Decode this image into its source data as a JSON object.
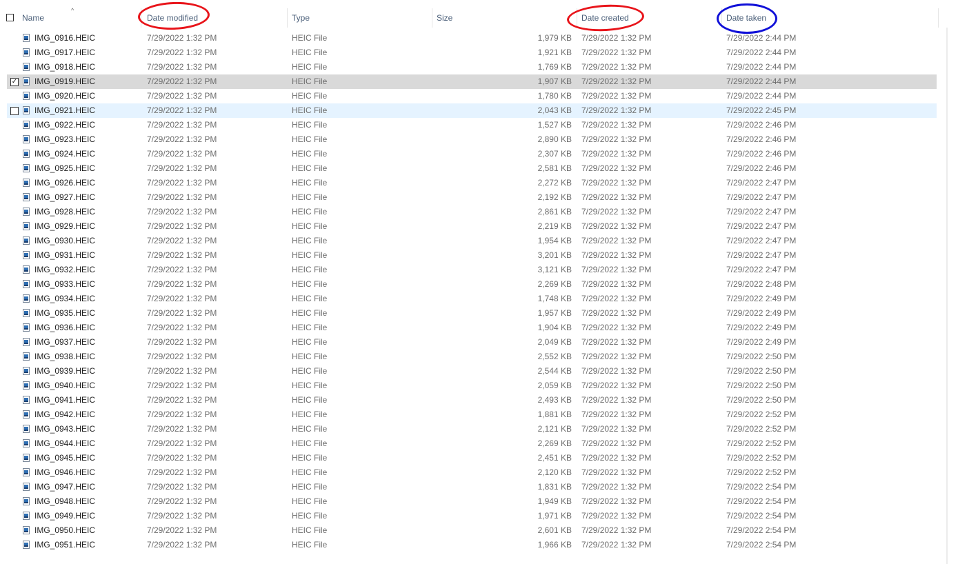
{
  "columns": {
    "name": "Name",
    "date_modified": "Date modified",
    "type": "Type",
    "size": "Size",
    "date_created": "Date created",
    "date_taken": "Date taken"
  },
  "annotation_colors": {
    "red": "#e8141a",
    "blue": "#1010d8"
  },
  "files": [
    {
      "name": "IMG_0916.HEIC",
      "modified": "7/29/2022 1:32 PM",
      "type": "HEIC File",
      "size": "1,979 KB",
      "created": "7/29/2022 1:32 PM",
      "taken": "7/29/2022 2:44 PM"
    },
    {
      "name": "IMG_0917.HEIC",
      "modified": "7/29/2022 1:32 PM",
      "type": "HEIC File",
      "size": "1,921 KB",
      "created": "7/29/2022 1:32 PM",
      "taken": "7/29/2022 2:44 PM"
    },
    {
      "name": "IMG_0918.HEIC",
      "modified": "7/29/2022 1:32 PM",
      "type": "HEIC File",
      "size": "1,769 KB",
      "created": "7/29/2022 1:32 PM",
      "taken": "7/29/2022 2:44 PM"
    },
    {
      "name": "IMG_0919.HEIC",
      "modified": "7/29/2022 1:32 PM",
      "type": "HEIC File",
      "size": "1,907 KB",
      "created": "7/29/2022 1:32 PM",
      "taken": "7/29/2022 2:44 PM",
      "state": "selected"
    },
    {
      "name": "IMG_0920.HEIC",
      "modified": "7/29/2022 1:32 PM",
      "type": "HEIC File",
      "size": "1,780 KB",
      "created": "7/29/2022 1:32 PM",
      "taken": "7/29/2022 2:44 PM"
    },
    {
      "name": "IMG_0921.HEIC",
      "modified": "7/29/2022 1:32 PM",
      "type": "HEIC File",
      "size": "2,043 KB",
      "created": "7/29/2022 1:32 PM",
      "taken": "7/29/2022 2:45 PM",
      "state": "hover"
    },
    {
      "name": "IMG_0922.HEIC",
      "modified": "7/29/2022 1:32 PM",
      "type": "HEIC File",
      "size": "1,527 KB",
      "created": "7/29/2022 1:32 PM",
      "taken": "7/29/2022 2:46 PM"
    },
    {
      "name": "IMG_0923.HEIC",
      "modified": "7/29/2022 1:32 PM",
      "type": "HEIC File",
      "size": "2,890 KB",
      "created": "7/29/2022 1:32 PM",
      "taken": "7/29/2022 2:46 PM"
    },
    {
      "name": "IMG_0924.HEIC",
      "modified": "7/29/2022 1:32 PM",
      "type": "HEIC File",
      "size": "2,307 KB",
      "created": "7/29/2022 1:32 PM",
      "taken": "7/29/2022 2:46 PM"
    },
    {
      "name": "IMG_0925.HEIC",
      "modified": "7/29/2022 1:32 PM",
      "type": "HEIC File",
      "size": "2,581 KB",
      "created": "7/29/2022 1:32 PM",
      "taken": "7/29/2022 2:46 PM"
    },
    {
      "name": "IMG_0926.HEIC",
      "modified": "7/29/2022 1:32 PM",
      "type": "HEIC File",
      "size": "2,272 KB",
      "created": "7/29/2022 1:32 PM",
      "taken": "7/29/2022 2:47 PM"
    },
    {
      "name": "IMG_0927.HEIC",
      "modified": "7/29/2022 1:32 PM",
      "type": "HEIC File",
      "size": "2,192 KB",
      "created": "7/29/2022 1:32 PM",
      "taken": "7/29/2022 2:47 PM"
    },
    {
      "name": "IMG_0928.HEIC",
      "modified": "7/29/2022 1:32 PM",
      "type": "HEIC File",
      "size": "2,861 KB",
      "created": "7/29/2022 1:32 PM",
      "taken": "7/29/2022 2:47 PM"
    },
    {
      "name": "IMG_0929.HEIC",
      "modified": "7/29/2022 1:32 PM",
      "type": "HEIC File",
      "size": "2,219 KB",
      "created": "7/29/2022 1:32 PM",
      "taken": "7/29/2022 2:47 PM"
    },
    {
      "name": "IMG_0930.HEIC",
      "modified": "7/29/2022 1:32 PM",
      "type": "HEIC File",
      "size": "1,954 KB",
      "created": "7/29/2022 1:32 PM",
      "taken": "7/29/2022 2:47 PM"
    },
    {
      "name": "IMG_0931.HEIC",
      "modified": "7/29/2022 1:32 PM",
      "type": "HEIC File",
      "size": "3,201 KB",
      "created": "7/29/2022 1:32 PM",
      "taken": "7/29/2022 2:47 PM"
    },
    {
      "name": "IMG_0932.HEIC",
      "modified": "7/29/2022 1:32 PM",
      "type": "HEIC File",
      "size": "3,121 KB",
      "created": "7/29/2022 1:32 PM",
      "taken": "7/29/2022 2:47 PM"
    },
    {
      "name": "IMG_0933.HEIC",
      "modified": "7/29/2022 1:32 PM",
      "type": "HEIC File",
      "size": "2,269 KB",
      "created": "7/29/2022 1:32 PM",
      "taken": "7/29/2022 2:48 PM"
    },
    {
      "name": "IMG_0934.HEIC",
      "modified": "7/29/2022 1:32 PM",
      "type": "HEIC File",
      "size": "1,748 KB",
      "created": "7/29/2022 1:32 PM",
      "taken": "7/29/2022 2:49 PM"
    },
    {
      "name": "IMG_0935.HEIC",
      "modified": "7/29/2022 1:32 PM",
      "type": "HEIC File",
      "size": "1,957 KB",
      "created": "7/29/2022 1:32 PM",
      "taken": "7/29/2022 2:49 PM"
    },
    {
      "name": "IMG_0936.HEIC",
      "modified": "7/29/2022 1:32 PM",
      "type": "HEIC File",
      "size": "1,904 KB",
      "created": "7/29/2022 1:32 PM",
      "taken": "7/29/2022 2:49 PM"
    },
    {
      "name": "IMG_0937.HEIC",
      "modified": "7/29/2022 1:32 PM",
      "type": "HEIC File",
      "size": "2,049 KB",
      "created": "7/29/2022 1:32 PM",
      "taken": "7/29/2022 2:49 PM"
    },
    {
      "name": "IMG_0938.HEIC",
      "modified": "7/29/2022 1:32 PM",
      "type": "HEIC File",
      "size": "2,552 KB",
      "created": "7/29/2022 1:32 PM",
      "taken": "7/29/2022 2:50 PM"
    },
    {
      "name": "IMG_0939.HEIC",
      "modified": "7/29/2022 1:32 PM",
      "type": "HEIC File",
      "size": "2,544 KB",
      "created": "7/29/2022 1:32 PM",
      "taken": "7/29/2022 2:50 PM"
    },
    {
      "name": "IMG_0940.HEIC",
      "modified": "7/29/2022 1:32 PM",
      "type": "HEIC File",
      "size": "2,059 KB",
      "created": "7/29/2022 1:32 PM",
      "taken": "7/29/2022 2:50 PM"
    },
    {
      "name": "IMG_0941.HEIC",
      "modified": "7/29/2022 1:32 PM",
      "type": "HEIC File",
      "size": "2,493 KB",
      "created": "7/29/2022 1:32 PM",
      "taken": "7/29/2022 2:50 PM"
    },
    {
      "name": "IMG_0942.HEIC",
      "modified": "7/29/2022 1:32 PM",
      "type": "HEIC File",
      "size": "1,881 KB",
      "created": "7/29/2022 1:32 PM",
      "taken": "7/29/2022 2:52 PM"
    },
    {
      "name": "IMG_0943.HEIC",
      "modified": "7/29/2022 1:32 PM",
      "type": "HEIC File",
      "size": "2,121 KB",
      "created": "7/29/2022 1:32 PM",
      "taken": "7/29/2022 2:52 PM"
    },
    {
      "name": "IMG_0944.HEIC",
      "modified": "7/29/2022 1:32 PM",
      "type": "HEIC File",
      "size": "2,269 KB",
      "created": "7/29/2022 1:32 PM",
      "taken": "7/29/2022 2:52 PM"
    },
    {
      "name": "IMG_0945.HEIC",
      "modified": "7/29/2022 1:32 PM",
      "type": "HEIC File",
      "size": "2,451 KB",
      "created": "7/29/2022 1:32 PM",
      "taken": "7/29/2022 2:52 PM"
    },
    {
      "name": "IMG_0946.HEIC",
      "modified": "7/29/2022 1:32 PM",
      "type": "HEIC File",
      "size": "2,120 KB",
      "created": "7/29/2022 1:32 PM",
      "taken": "7/29/2022 2:52 PM"
    },
    {
      "name": "IMG_0947.HEIC",
      "modified": "7/29/2022 1:32 PM",
      "type": "HEIC File",
      "size": "1,831 KB",
      "created": "7/29/2022 1:32 PM",
      "taken": "7/29/2022 2:54 PM"
    },
    {
      "name": "IMG_0948.HEIC",
      "modified": "7/29/2022 1:32 PM",
      "type": "HEIC File",
      "size": "1,949 KB",
      "created": "7/29/2022 1:32 PM",
      "taken": "7/29/2022 2:54 PM"
    },
    {
      "name": "IMG_0949.HEIC",
      "modified": "7/29/2022 1:32 PM",
      "type": "HEIC File",
      "size": "1,971 KB",
      "created": "7/29/2022 1:32 PM",
      "taken": "7/29/2022 2:54 PM"
    },
    {
      "name": "IMG_0950.HEIC",
      "modified": "7/29/2022 1:32 PM",
      "type": "HEIC File",
      "size": "2,601 KB",
      "created": "7/29/2022 1:32 PM",
      "taken": "7/29/2022 2:54 PM"
    },
    {
      "name": "IMG_0951.HEIC",
      "modified": "7/29/2022 1:32 PM",
      "type": "HEIC File",
      "size": "1,966 KB",
      "created": "7/29/2022 1:32 PM",
      "taken": "7/29/2022 2:54 PM"
    }
  ]
}
